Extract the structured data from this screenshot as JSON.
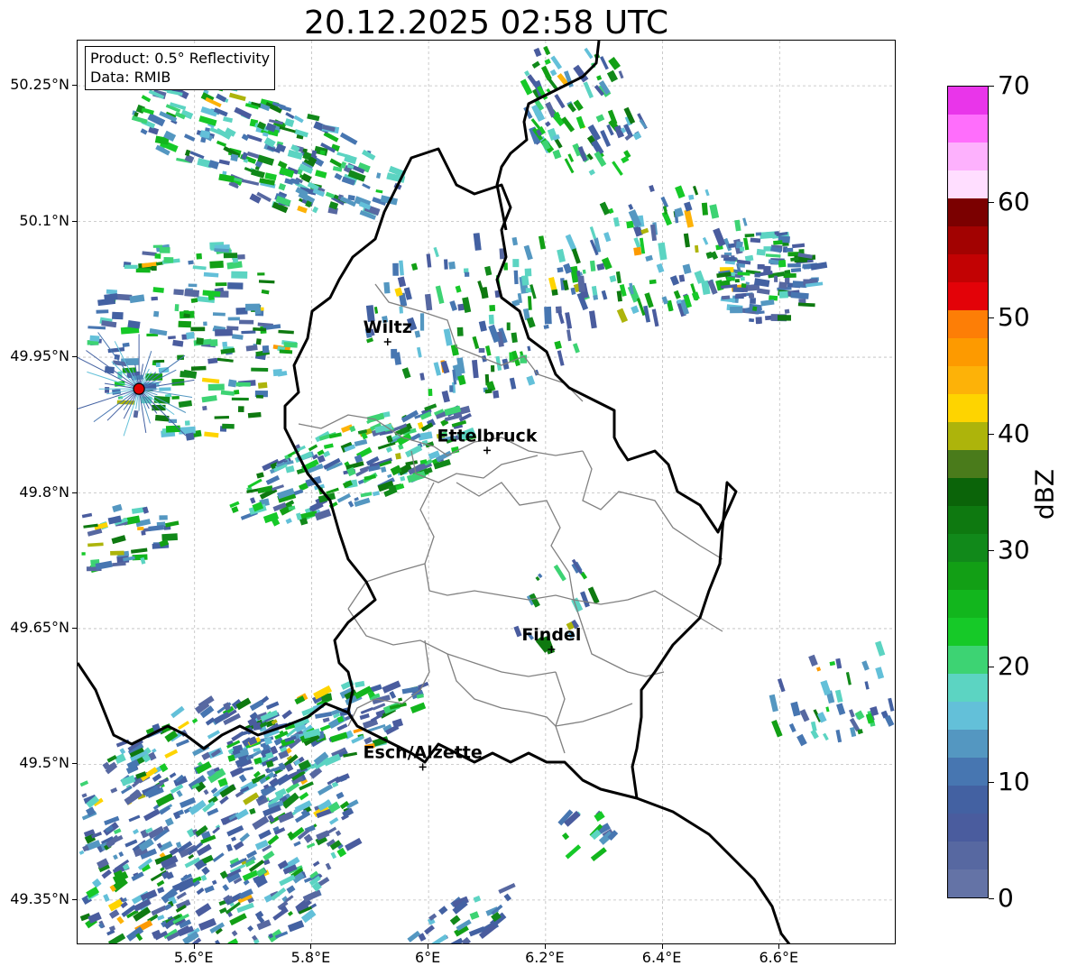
{
  "title": "20.12.2025 02:58 UTC",
  "info": {
    "product": "Product: 0.5° Reflectivity",
    "data": "Data: RMIB"
  },
  "lat_labels": [
    "50.25°N",
    "50.1°N",
    "49.95°N",
    "49.8°N",
    "49.65°N",
    "49.5°N",
    "49.35°N"
  ],
  "lon_labels": [
    "5.6°E",
    "5.8°E",
    "6°E",
    "6.2°E",
    "6.4°E",
    "6.6°E"
  ],
  "cities": [
    {
      "name": "Wiltz",
      "lon": 5.93,
      "lat": 49.967
    },
    {
      "name": "Ettelbruck",
      "lon": 6.1,
      "lat": 49.847
    },
    {
      "name": "Findel",
      "lon": 6.21,
      "lat": 49.627
    },
    {
      "name": "Esch/Alzette",
      "lon": 5.99,
      "lat": 49.497
    }
  ],
  "radar_site": {
    "lon": 5.505,
    "lat": 49.915
  },
  "map_extent": {
    "lon_min": 5.4,
    "lon_max": 6.8,
    "lat_min": 49.3,
    "lat_max": 50.3
  },
  "colorbar": {
    "unit": "dBZ",
    "labels": [
      "0",
      "10",
      "20",
      "30",
      "40",
      "50",
      "60",
      "70"
    ],
    "min": 0,
    "max": 70,
    "step": 2.5,
    "colors": [
      "#6473a6",
      "#5768a1",
      "#4a5c9e",
      "#4361a2",
      "#4776b1",
      "#5497c1",
      "#63c0d9",
      "#5cd4c2",
      "#3dd373",
      "#16c928",
      "#12b61d",
      "#129f15",
      "#11891a",
      "#0e7910",
      "#0b6409",
      "#4a7b1b",
      "#adb40b",
      "#fed400",
      "#fdb208",
      "#fd9a00",
      "#fd7e06",
      "#e30208",
      "#c20203",
      "#a20201",
      "#7b0000",
      "#ffdeff",
      "#fdb1fd",
      "#ff6efc",
      "#e935ea"
    ]
  }
}
